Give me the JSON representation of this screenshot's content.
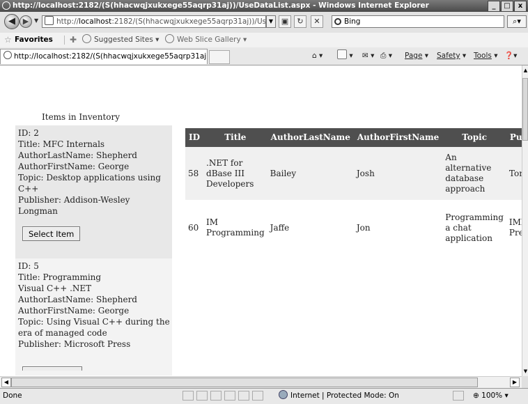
{
  "window": {
    "title": "http://localhost:2182/(S(hhacwqjxukxege55aqrp31aj))/UseDataList.aspx - Windows Internet Explorer",
    "buttons": [
      "_",
      "□",
      "x"
    ]
  },
  "address_bar": {
    "prefix": "http://",
    "host": "localhost",
    "rest": ":2182/(S(hhacwqjxukxege55aqrp31aj))/Use",
    "search_text": "Bing"
  },
  "favorites_bar": {
    "label": "Favorites",
    "items": [
      "Suggested Sites ▾",
      "Web Slice Gallery ▾"
    ]
  },
  "tab": {
    "title": "http://localhost:2182/(S(hhacwqjxukxege55aqrp31aj..."
  },
  "command_bar": {
    "page": "Page",
    "safety": "Safety",
    "tools": "Tools"
  },
  "content": {
    "caption": "Items in Inventory",
    "items": [
      {
        "id": "ID: 2",
        "title": "Title: MFC Internals",
        "author_last": "AuthorLastName: Shepherd",
        "author_first": "AuthorFirstName: George",
        "topic": "Topic: Desktop applications using C++",
        "publisher": "Publisher: Addison-Wesley Longman",
        "button": "Select Item"
      },
      {
        "id": "ID: 5",
        "title": "Title: Programming Visual C++ .NET",
        "author_last": "AuthorLastName: Shepherd",
        "author_first": "AuthorFirstName: George",
        "topic": "Topic: Using Visual C++ during the era of managed code",
        "publisher": "Publisher: Microsoft Press"
      }
    ],
    "grid": {
      "headers": [
        "ID",
        "Title",
        "AuthorLastName",
        "AuthorFirstName",
        "Topic",
        "Publ"
      ],
      "rows": [
        {
          "id": "58",
          "title": ".NET for dBase III Developers",
          "last": "Bailey",
          "first": "Josh",
          "topic": "An alternative database approach",
          "publisher": "Tonash"
        },
        {
          "id": "60",
          "title": "IM Programming",
          "last": "Jaffe",
          "first": "Jon",
          "topic": "Programming a chat application",
          "publisher": "IMProg Press"
        }
      ]
    }
  },
  "status_bar": {
    "status": "Done",
    "zone": "Internet | Protected Mode: On",
    "zoom": "100%"
  }
}
